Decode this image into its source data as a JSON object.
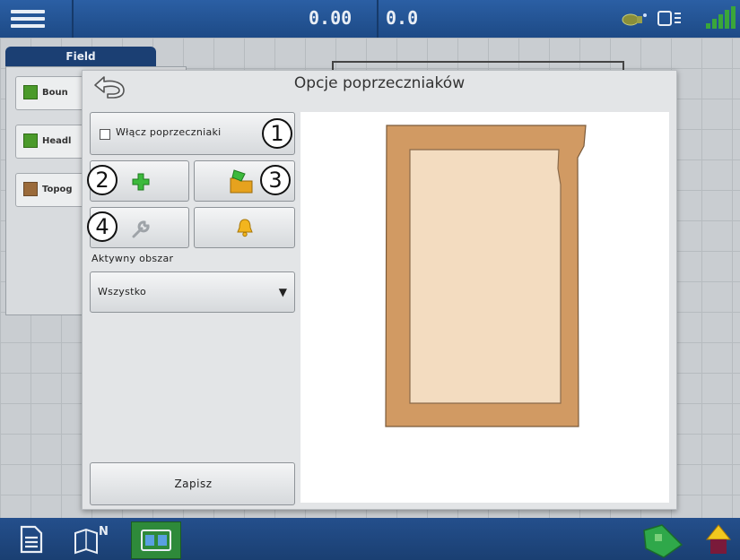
{
  "topbar": {
    "speed": "0.00",
    "heading": "0.0",
    "icons": [
      "menu-icon",
      "gps-icon",
      "display-icon",
      "signal-icon"
    ]
  },
  "background": {
    "field_tab": "Field",
    "field_items": [
      "Boun",
      "Headl",
      "Topog"
    ]
  },
  "dialog": {
    "title": "Opcje poprzeczniaków",
    "enable_label": "Włącz poprzeczniaki",
    "active_area_label": "Aktywny obszar",
    "active_area_value": "Wszystko",
    "save_label": "Zapisz",
    "callouts": [
      "1",
      "2",
      "3",
      "4"
    ],
    "icons": [
      "back-arrow-icon",
      "checkbox-icon",
      "add-plus-icon",
      "folder-icon",
      "wrench-icon",
      "bell-icon",
      "dropdown-arrow-icon"
    ]
  },
  "preview": {
    "outer_fill": "#d19a63",
    "inner_fill": "#f3dcc0"
  },
  "bottombar": {
    "icons": [
      "document-icon",
      "map-north-icon",
      "split-view-icon",
      "green-field-icon",
      "warning-up-icon"
    ],
    "active_color": "#2e8a3a"
  }
}
